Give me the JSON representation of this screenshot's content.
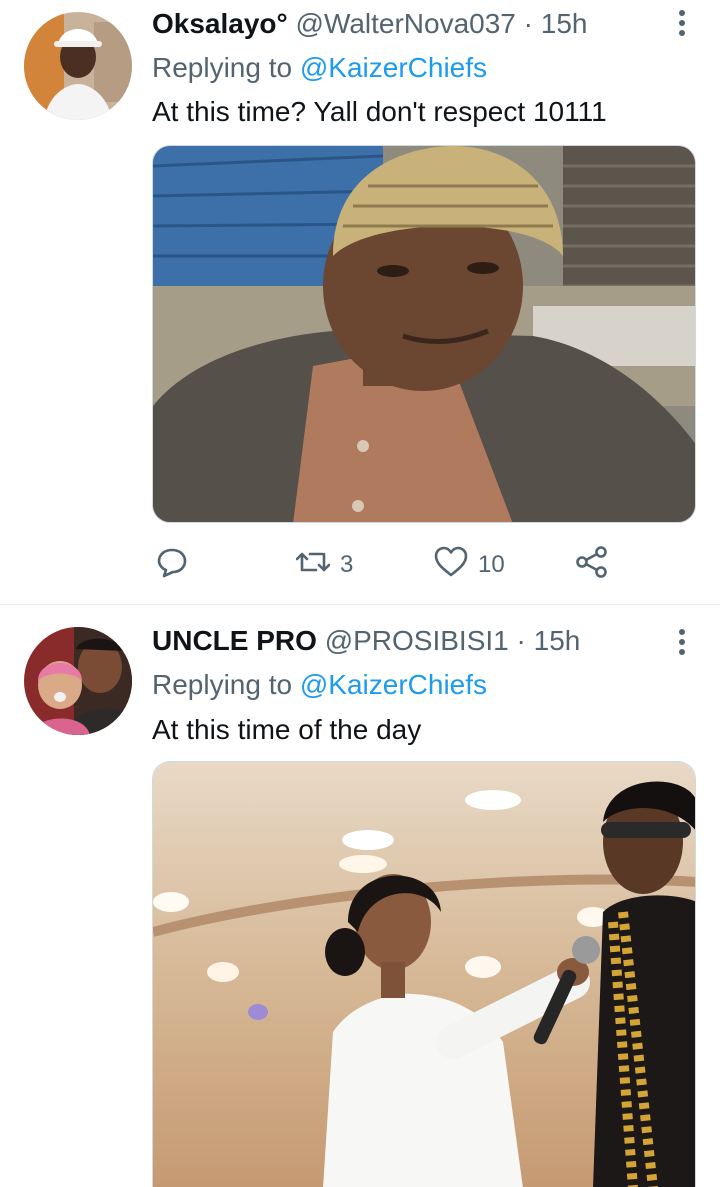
{
  "tweets": [
    {
      "display_name": "Oksalayo°",
      "handle": "@WalterNova037",
      "separator": "·",
      "time": "15h",
      "replying_prefix": "Replying to",
      "replying_to": "@KaizerChiefs",
      "text": "At this time? Yall don't respect 10111",
      "retweets": "3",
      "likes": "10",
      "avatar_icon": "profile-photo-white-cap",
      "media_icon": "photo-man-in-knitted-hat"
    },
    {
      "display_name": "UNCLE PRO",
      "handle": "@PROSIBISI1",
      "separator": "·",
      "time": "15h",
      "replying_prefix": "Replying to",
      "replying_to": "@KaizerChiefs",
      "text": "At this time of the day",
      "avatar_icon": "profile-photo-man-with-baby",
      "media_icon": "photo-presenter-interviewing-man"
    }
  ],
  "icons": {
    "reply": "reply-icon",
    "retweet": "retweet-icon",
    "like": "heart-icon",
    "share": "share-icon",
    "more": "more-options-icon"
  },
  "colors": {
    "text_primary": "#0f1419",
    "text_secondary": "#536471",
    "link": "#1d9bf0",
    "divider": "#e6ecf0"
  }
}
